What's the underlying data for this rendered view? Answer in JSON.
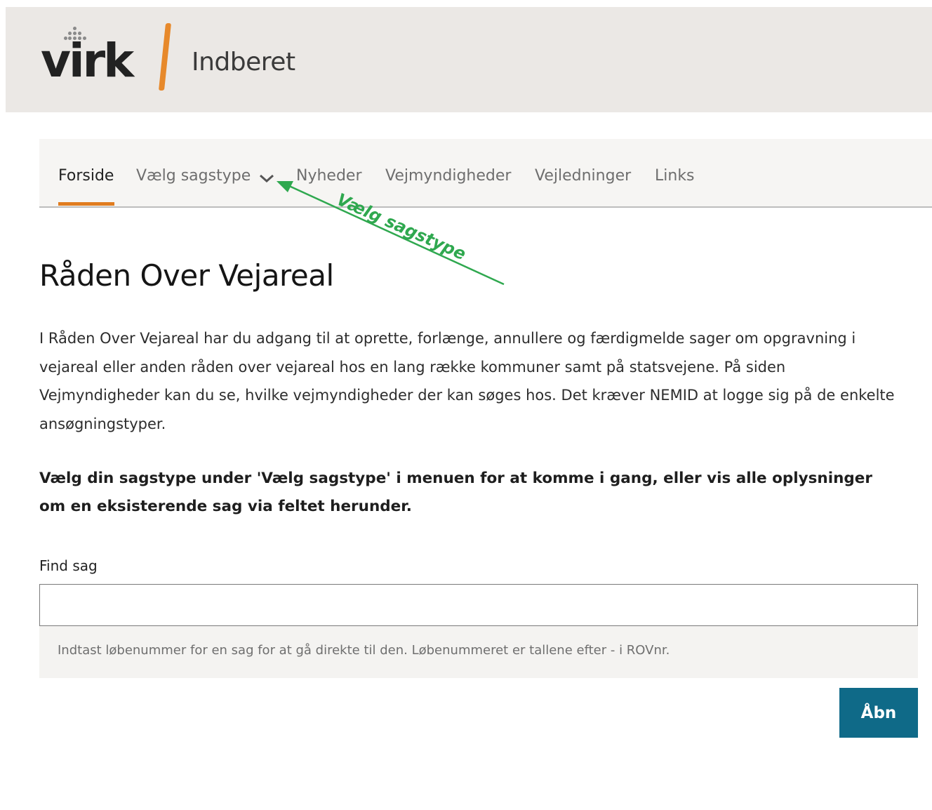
{
  "header": {
    "logo_text": "virk",
    "app_title": "Indberet",
    "logo_bar_color": "#e7892b"
  },
  "nav": {
    "items": [
      {
        "label": "Forside",
        "active": true
      },
      {
        "label": "Vælg sagstype",
        "has_dropdown": true
      },
      {
        "label": "Nyheder"
      },
      {
        "label": "Vejmyndigheder"
      },
      {
        "label": "Vejledninger"
      },
      {
        "label": "Links"
      }
    ],
    "active_color": "#e07c1f"
  },
  "annotation": {
    "label": "Vælg sagstype",
    "color": "#2fa84f"
  },
  "main": {
    "title": "Råden Over Vejareal",
    "intro": "I Råden Over Vejareal har du adgang til at oprette, forlænge, annullere og færdigmelde sager om opgravning i vejareal eller anden råden over vejareal hos en lang række kommuner samt på statsvejene. På siden Vejmyndigheder kan du se, hvilke vejmyndigheder der kan søges hos. Det kræver NEMID at logge sig på de enkelte ansøgningstyper.",
    "lead": "Vælg din sagstype under 'Vælg sagstype' i menuen for at komme i gang, eller vis alle oplysninger om en eksisterende sag via feltet herunder."
  },
  "find_case": {
    "label": "Find sag",
    "value": "",
    "placeholder": "",
    "help": "Indtast løbenummer for en sag for at gå direkte til den. Løbenummeret er tallene efter - i ROVnr.",
    "button_label": "Åbn",
    "button_color": "#0f6a88"
  }
}
